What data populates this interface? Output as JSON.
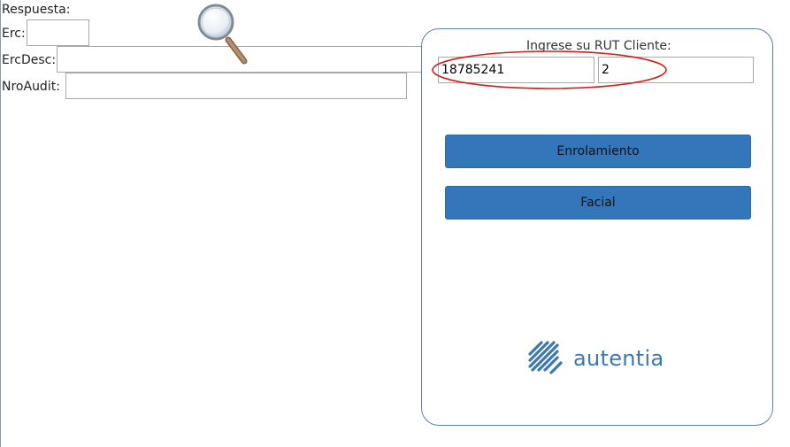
{
  "response": {
    "heading": "Respuesta:",
    "erc_label": "Erc:",
    "erc_value": "",
    "ercdesc_label": "ErcDesc:",
    "ercdesc_value": "",
    "nroaudit_label": "NroAudit:",
    "nroaudit_value": ""
  },
  "panel": {
    "title": "Ingrese su RUT Cliente:",
    "rut_value": "18785241",
    "dv_value": "2",
    "enrolamiento_label": "Enrolamiento",
    "facial_label": "Facial",
    "logo_text": "autentia"
  },
  "colors": {
    "button_blue": "#3476ba",
    "annotation_red": "#d11f1f",
    "brand_blue": "#3a78b5"
  },
  "icons": {
    "magnifier": "magnifying-glass-icon",
    "logo_mark": "autentia-logo-icon"
  }
}
